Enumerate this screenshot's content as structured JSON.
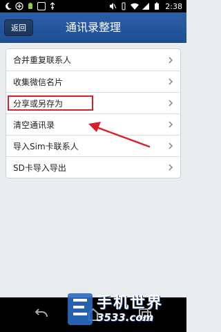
{
  "status_bar": {
    "time": "2:38"
  },
  "header": {
    "back_label": "返回",
    "title": "通讯录整理"
  },
  "menu": {
    "items": [
      {
        "label": "合并重复联系人"
      },
      {
        "label": "收集微信名片"
      },
      {
        "label": "分享或另存为"
      },
      {
        "label": "清空通讯录"
      },
      {
        "label": "导入Sim卡联系人"
      },
      {
        "label": "SD卡导入导出"
      }
    ]
  },
  "watermark": {
    "brand": "手机世界",
    "site": "3533.com"
  },
  "colors": {
    "header": "#2b5fa8",
    "highlight": "#d6212a",
    "background": "#e9ecef"
  }
}
